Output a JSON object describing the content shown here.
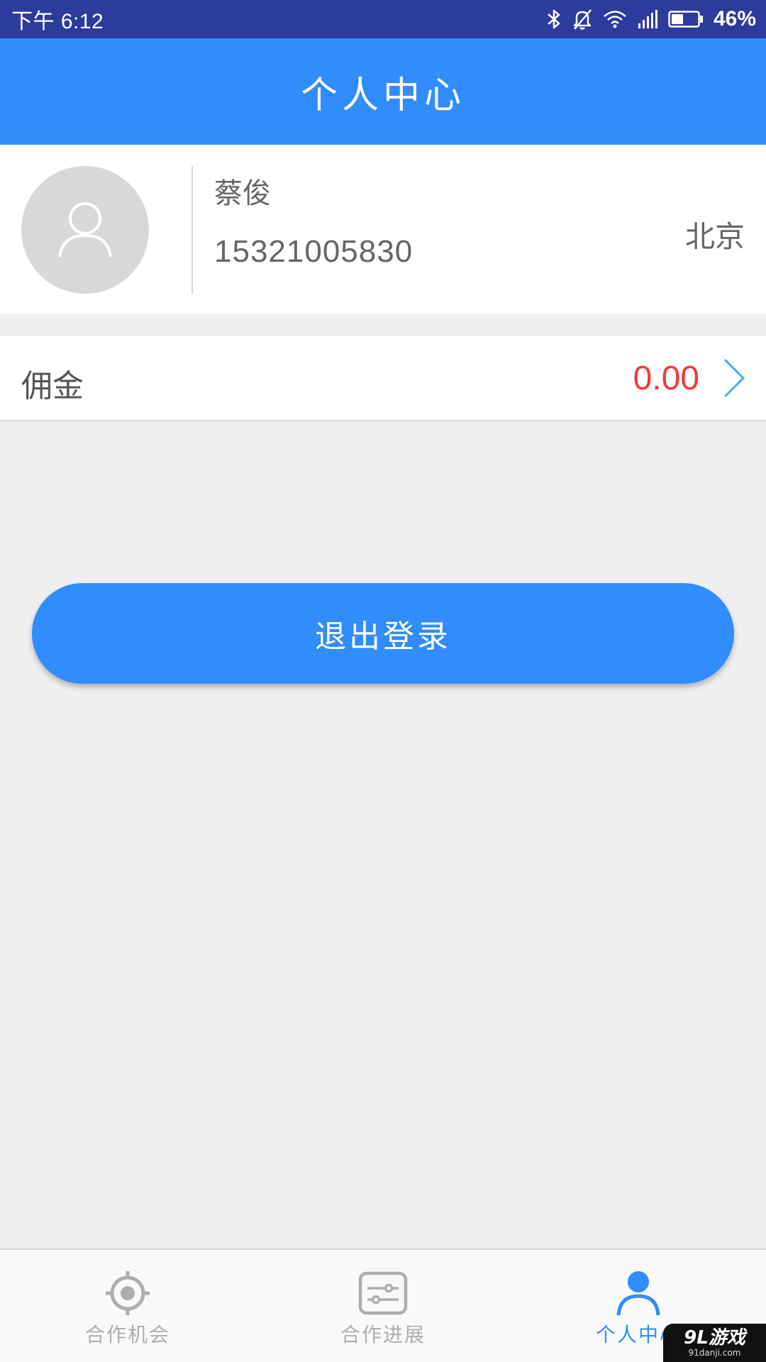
{
  "status_bar": {
    "time": "下午 6:12",
    "battery_percent": "46%",
    "battery_level": 0.46,
    "icons": [
      "bluetooth-icon",
      "bell-muted-icon",
      "wifi-icon",
      "cellular-signal-icon",
      "battery-icon"
    ]
  },
  "header": {
    "title": "个人中心"
  },
  "profile": {
    "name": "蔡俊",
    "phone": "15321005830",
    "city": "北京",
    "avatar_icon": "user-placeholder-icon"
  },
  "commission": {
    "label": "佣金",
    "value": "0.00",
    "arrow_icon": "chevron-right-icon"
  },
  "actions": {
    "logout_label": "退出登录"
  },
  "tabs": [
    {
      "label": "合作机会",
      "icon": "target-icon",
      "active": false
    },
    {
      "label": "合作进展",
      "icon": "sliders-icon",
      "active": false
    },
    {
      "label": "个人中心",
      "icon": "person-icon",
      "active": true
    }
  ],
  "watermark": {
    "main": "9L游戏",
    "sub": "91danji.com"
  },
  "colors": {
    "primary": "#318cfe",
    "status_bar": "#2d3b9c",
    "amount": "#f23a3a",
    "background": "#efeff1"
  }
}
